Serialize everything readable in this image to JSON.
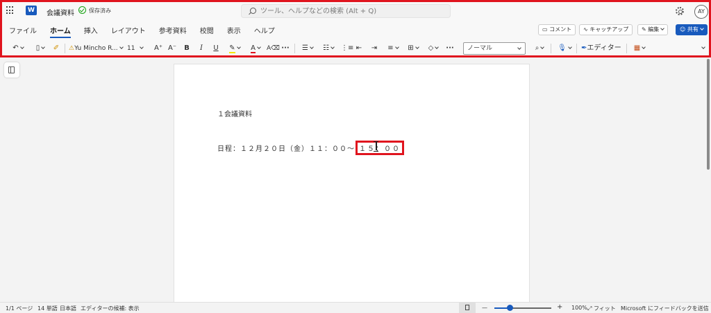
{
  "titlebar": {
    "app_letter": "W",
    "doc_title": "会議資料",
    "saved_status": "保存済み",
    "search_placeholder": "ツール、ヘルプなどの検索 (Alt + Q)",
    "avatar_initials": "AY"
  },
  "tabs": [
    "ファイル",
    "ホーム",
    "挿入",
    "レイアウト",
    "参考資料",
    "校閲",
    "表示",
    "ヘルプ"
  ],
  "active_tab": "ホーム",
  "right_buttons": {
    "comment": "コメント",
    "catchup": "キャッチアップ",
    "edit": "編集",
    "share": "共有"
  },
  "toolbar": {
    "font_name": "Yu Mincho R...",
    "font_size": "11",
    "grow_font": "A⁺",
    "shrink_font": "A⁻",
    "bold": "B",
    "italic": "I",
    "underline": "U",
    "more": "···",
    "style_name": "ノーマル",
    "editor_label": "エディター"
  },
  "document": {
    "line1": "１会議資料",
    "line2_prefix": "日程：１２月２０日（金）１１：００～",
    "line2_highlight": "１５：００"
  },
  "statusbar": {
    "page": "1/1 ページ",
    "words": "14 単語",
    "language": "日本語",
    "editor_suggestions": "エディターの候補: 表示",
    "zoom_percent": "100%",
    "fit": "フィット",
    "feedback": "Microsoft にフィードバックを送信",
    "zoom_minus": "—",
    "zoom_plus": "+",
    "zoom_level": 0.27
  },
  "colors": {
    "accent": "#185abd",
    "highlight_border": "#e0141e",
    "saved_green": "#13a10e"
  }
}
